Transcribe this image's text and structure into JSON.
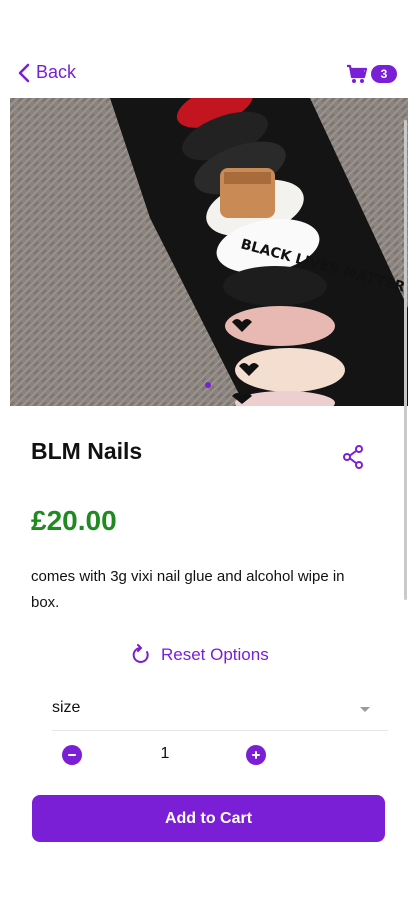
{
  "header": {
    "back_label": "Back",
    "cart_count": "3"
  },
  "product": {
    "image_alt": "nails photo",
    "title": "BLM Nails",
    "price": "£20.00",
    "description": "comes with 3g vixi nail glue and alcohol wipe in box.",
    "image_text": "BLACK LIVES MATTER"
  },
  "options": {
    "reset_label": "Reset Options",
    "size_label": "size",
    "quantity": "1"
  },
  "actions": {
    "add_to_cart_label": "Add to Cart"
  },
  "colors": {
    "accent": "#7a1fd6",
    "price": "#1f8a1f"
  },
  "icons": [
    "chevron-left-icon",
    "cart-icon",
    "share-icon",
    "reset-icon",
    "minus-icon",
    "plus-icon",
    "caret-down-icon"
  ]
}
